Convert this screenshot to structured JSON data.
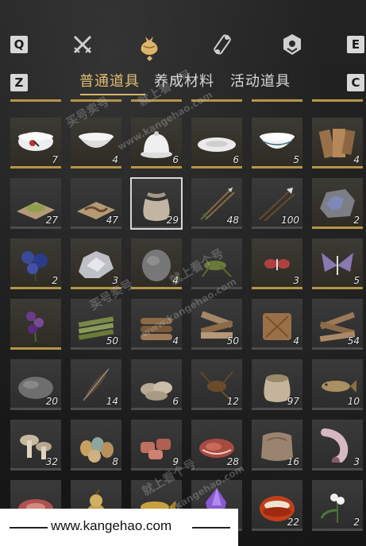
{
  "keys": {
    "left_top": "Q",
    "right_top": "E",
    "left_tab": "Z",
    "right_tab": "C"
  },
  "top_icons": [
    "crossed-swords-icon",
    "money-pouch-icon",
    "scroll-icon",
    "badge-icon"
  ],
  "tabs": [
    {
      "label": "普通道具",
      "active": true
    },
    {
      "label": "养成材料",
      "active": false
    },
    {
      "label": "活动道具",
      "active": false
    }
  ],
  "partial_row_counts": [
    "20",
    "6",
    "2",
    "3"
  ],
  "rows": [
    [
      {
        "icon": "rooster-bowl-icon",
        "count": "7",
        "gold": true
      },
      {
        "icon": "white-bowl-icon",
        "count": "4",
        "gold": true
      },
      {
        "icon": "lidded-bowl-icon",
        "count": "6",
        "gold": true
      },
      {
        "icon": "white-plate-icon",
        "count": "6",
        "gold": true
      },
      {
        "icon": "porcelain-bowl-icon",
        "count": "5",
        "gold": true
      },
      {
        "icon": "wooden-tablets-icon",
        "count": "4",
        "gold": true
      }
    ],
    [
      {
        "icon": "green-powder-icon",
        "count": "27",
        "gold": false
      },
      {
        "icon": "worm-on-cloth-icon",
        "count": "47",
        "gold": false
      },
      {
        "icon": "cloth-sack-icon",
        "count": "29",
        "gold": false,
        "selected": true
      },
      {
        "icon": "arrows-icon",
        "count": "48",
        "gold": false
      },
      {
        "icon": "spear-arrows-icon",
        "count": "100",
        "gold": false
      },
      {
        "icon": "ore-stone-icon",
        "count": "2",
        "gold": true
      }
    ],
    [
      {
        "icon": "blue-flower-icon",
        "count": "2",
        "gold": true
      },
      {
        "icon": "silver-ore-icon",
        "count": "3",
        "gold": true
      },
      {
        "icon": "grey-stone-icon",
        "count": "4",
        "gold": true
      },
      {
        "icon": "grasshopper-icon",
        "count": "",
        "gold": false
      },
      {
        "icon": "red-butterfly-icon",
        "count": "3",
        "gold": true
      },
      {
        "icon": "purple-moth-icon",
        "count": "5",
        "gold": true
      }
    ],
    [
      {
        "icon": "purple-herb-icon",
        "count": "",
        "gold": true
      },
      {
        "icon": "bamboo-bundle-icon",
        "count": "50",
        "gold": false
      },
      {
        "icon": "log-pile-icon",
        "count": "4",
        "gold": false
      },
      {
        "icon": "wood-planks-icon",
        "count": "50",
        "gold": false
      },
      {
        "icon": "straw-bundle-icon",
        "count": "4",
        "gold": false
      },
      {
        "icon": "timber-icon",
        "count": "54",
        "gold": false
      }
    ],
    [
      {
        "icon": "rock-icon",
        "count": "20",
        "gold": false
      },
      {
        "icon": "feather-icon",
        "count": "14",
        "gold": false
      },
      {
        "icon": "shell-pile-icon",
        "count": "6",
        "gold": false
      },
      {
        "icon": "cricket-icon",
        "count": "12",
        "gold": false
      },
      {
        "icon": "grain-sack-icon",
        "count": "97",
        "gold": false
      },
      {
        "icon": "fish-icon",
        "count": "10",
        "gold": false
      }
    ],
    [
      {
        "icon": "mushrooms-icon",
        "count": "32",
        "gold": false
      },
      {
        "icon": "eggs-icon",
        "count": "8",
        "gold": false
      },
      {
        "icon": "meat-chunks-icon",
        "count": "9",
        "gold": false
      },
      {
        "icon": "steak-icon",
        "count": "28",
        "gold": false
      },
      {
        "icon": "animal-hide-icon",
        "count": "16",
        "gold": false
      },
      {
        "icon": "pig-trotters-icon",
        "count": "3",
        "gold": false
      }
    ],
    [
      {
        "icon": "raw-meat-icon",
        "count": "",
        "gold": false
      },
      {
        "icon": "gourd-icon",
        "count": "",
        "gold": false
      },
      {
        "icon": "golden-fish-icon",
        "count": "",
        "gold": false
      },
      {
        "icon": "purple-crystal-icon",
        "count": "",
        "gold": false
      },
      {
        "icon": "red-gem-icon",
        "count": "22",
        "gold": false
      },
      {
        "icon": "white-orchid-icon",
        "count": "2",
        "gold": false
      }
    ]
  ],
  "watermarks": {
    "site_cn": "就上看个号",
    "trade_cn": "买号卖号",
    "domain": "www.kangehao.com"
  },
  "footer": {
    "url": "www.kangehao.com"
  },
  "colors": {
    "gold": "#d9b36c",
    "cell": "#333333",
    "gold_border": "#b59549"
  }
}
